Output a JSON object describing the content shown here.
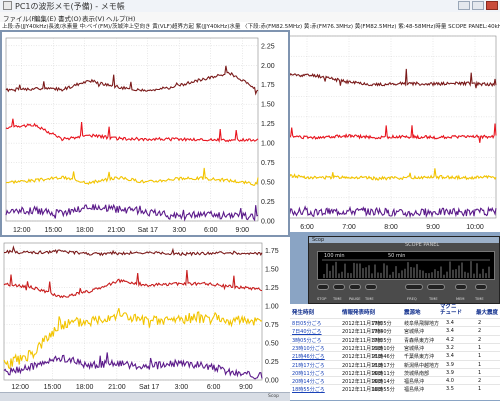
{
  "window": {
    "title": "PC1の波形メモ(予備) - メモ帳"
  },
  "menu": [
    {
      "label": "ファイル(F)"
    },
    {
      "label": "編集(E)"
    },
    {
      "label": "書式(O)"
    },
    {
      "label": "表示(V)"
    },
    {
      "label": "ヘルプ(H)"
    }
  ],
  "notepad": {
    "text": "上段:赤(JJY40kHz)長波/水素量 中:ベイ(FM)/茨城沖上空向き 黄(VLF)超界方起 紫(JJY40kHz)水量 〈下段:赤(FM82.5MHz) 黄:赤(FM76.3MHz) 黄(FM82.5MHz) 紫:48-58MHz)時量 SCOPE PANEL:40kHz)電界強度"
  },
  "chart_data": [
    {
      "type": "line",
      "title": "",
      "x_ticks": [
        "12:00",
        "15:00",
        "18:00",
        "21:00",
        "Sat 17",
        "3:00",
        "6:00",
        "9:00"
      ],
      "y_ticks": [
        0.0,
        0.25,
        0.5,
        0.75,
        1.0,
        1.25,
        1.5,
        1.75,
        2.0,
        2.25
      ],
      "ylim": [
        0,
        2.35
      ],
      "grid": true,
      "series": [
        {
          "color": "#7a1a1a",
          "values": [
            1.68,
            1.7,
            1.69,
            1.8,
            1.72,
            1.67,
            1.72,
            1.82,
            1.9,
            1.68
          ]
        },
        {
          "color": "#e8141e",
          "values": [
            1.2,
            1.24,
            1.05,
            1.1,
            1.06,
            1.05,
            1.05,
            1.04,
            1.04,
            1.04
          ]
        },
        {
          "color": "#f2c400",
          "values": [
            0.5,
            0.52,
            0.56,
            0.49,
            0.56,
            0.5,
            0.54,
            0.55,
            0.52,
            0.47
          ]
        },
        {
          "color": "#5b1a8a",
          "values": [
            0.12,
            0.14,
            0.1,
            0.18,
            0.15,
            0.12,
            0.06,
            0.08,
            0.07,
            0.05
          ]
        }
      ]
    },
    {
      "type": "line",
      "title": "",
      "x_ticks": [
        "6:00",
        "7:00",
        "8:00",
        "9:00",
        "10:00"
      ],
      "grid": true,
      "ylim": [
        0,
        2.35
      ],
      "series": [
        {
          "color": "#7a1a1a",
          "values": [
            1.85,
            1.84,
            1.76,
            1.72,
            1.74,
            1.73,
            1.74,
            1.72
          ]
        },
        {
          "color": "#e8141e",
          "values": [
            1.05,
            1.04,
            1.06,
            1.04,
            1.05,
            1.04,
            1.05,
            1.05
          ]
        },
        {
          "color": "#f2c400",
          "values": [
            0.55,
            0.52,
            0.53,
            0.51,
            0.52,
            0.53,
            0.52,
            0.53
          ]
        },
        {
          "color": "#5b1a8a",
          "values": [
            0.08,
            0.07,
            0.09,
            0.08,
            0.06,
            0.08,
            0.07,
            0.08
          ]
        }
      ]
    },
    {
      "type": "line",
      "title": "",
      "x_ticks": [
        "12:00",
        "15:00",
        "18:00",
        "21:00",
        "Sat 17",
        "3:00",
        "6:00",
        "9:00"
      ],
      "y_ticks": [
        0.0,
        0.25,
        0.5,
        0.75,
        1.0,
        1.25,
        1.5,
        1.75
      ],
      "ylim": [
        0,
        1.85
      ],
      "grid": true,
      "series": [
        {
          "color": "#7a1a1a",
          "values": [
            1.73,
            1.72,
            1.74,
            1.7,
            1.71,
            1.72,
            1.7,
            1.71,
            1.72,
            1.7
          ]
        },
        {
          "color": "#c81e1e",
          "values": [
            1.3,
            1.25,
            1.12,
            1.2,
            1.34,
            1.28,
            1.3,
            1.3,
            1.26,
            1.22
          ]
        },
        {
          "color": "#f2c400",
          "values": [
            0.2,
            0.35,
            0.75,
            0.8,
            0.9,
            0.78,
            0.82,
            0.85,
            0.8,
            0.82
          ]
        },
        {
          "color": "#5b1a8a",
          "values": [
            0.1,
            0.18,
            0.3,
            0.2,
            0.22,
            0.18,
            0.22,
            0.2,
            0.1,
            0.05
          ]
        }
      ]
    }
  ],
  "scope": {
    "title": "Scop",
    "label": "SCOPE PANEL",
    "screen_left": "100 min",
    "screen_mid": "50 min",
    "buttons": [
      "STOP",
      "TIME",
      "PAUSE",
      "TIME",
      "FREQ",
      "TIME",
      "MEM",
      "TIME"
    ]
  },
  "events_table": {
    "headers": [
      "発生時刻",
      "情報発表時刻",
      "震源地",
      "マグニ チュード",
      "最大震度"
    ],
    "rows": [
      [
        "8日05分ごろ",
        "2012年11月17日",
        "7時05分",
        "岐阜県飛騨地方",
        "3.4",
        "2"
      ],
      [
        "7日40分ごろ",
        "2012年11月17日",
        "7時40分",
        "宮城県沖",
        "3.4",
        "2"
      ],
      [
        "3時05分ごろ",
        "2012年11月17日",
        "3時05分",
        "青森県東方沖",
        "4.2",
        "2"
      ],
      [
        "23時10分ごろ",
        "2012年11月16日",
        "23時10分",
        "宮城県沖",
        "3.2",
        "1"
      ],
      [
        "21時46分ごろ",
        "2012年11月16日",
        "21時46分",
        "千葉県東方沖",
        "3.4",
        "1"
      ],
      [
        "21時17分ごろ",
        "2012年11月16日",
        "21時17分",
        "新潟県中越地方",
        "3.9",
        "1"
      ],
      [
        "20時11分ごろ",
        "2012年11月16日",
        "20時11分",
        "茨城県南部",
        "3.9",
        "1"
      ],
      [
        "20時14分ごろ",
        "2012年11月16日",
        "20時14分",
        "福島県沖",
        "4.0",
        "2"
      ],
      [
        "18時55分ごろ",
        "2012年11月16日",
        "18時55分",
        "福島県沖",
        "3.5",
        "1"
      ]
    ]
  },
  "status_bar": {
    "label": "Scop"
  }
}
